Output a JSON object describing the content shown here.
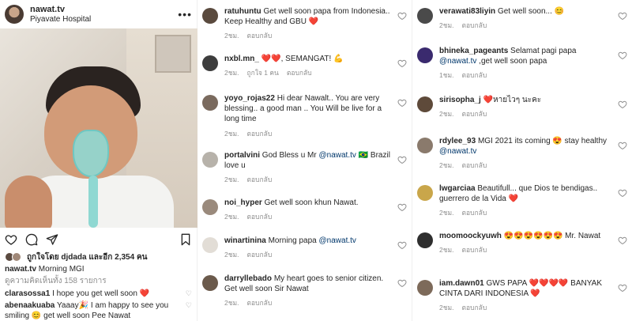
{
  "post": {
    "username": "nawat.tv",
    "location": "Piyavate Hospital",
    "likes_text": "ถูกใจโดย djdada และอีก 2,354 คน",
    "caption_user": "nawat.tv",
    "caption_text": "Morning MGI",
    "view_all": "ดูความคิดเห็นทั้ง 158 รายการ",
    "comments": [
      {
        "user": "clarasossa1",
        "text": "I hope you get well soon ❤️"
      },
      {
        "user": "abenaakuaba",
        "text": "Yaaay🎉 I am happy to see you smiling 😊 get well soon Pee Nawat"
      }
    ]
  },
  "comments_mid": [
    {
      "user": "ratuhuntu",
      "text": "Get well soon papa from Indonesia.. Keep Healthy and GBU ❤️",
      "time": "2ชม.",
      "likes": "",
      "reply": "ตอบกลับ",
      "avatar_color": "#5a4a3e"
    },
    {
      "user": "nxbl.mn_",
      "text": "❤️❤️, SEMANGAT! 💪",
      "time": "2ชม.",
      "likes": "ถูกใจ 1 คน",
      "reply": "ตอบกลับ",
      "avatar_color": "#3d3d3d"
    },
    {
      "user": "yoyo_rojas22",
      "text": "Hi dear Nawalt.. You are very blessing.. a good man .. You Will be live for a long time",
      "time": "2ชม.",
      "likes": "",
      "reply": "ตอบกลับ",
      "avatar_color": "#7a6a5e"
    },
    {
      "user": "portalvini",
      "text": "God Bless u Mr",
      "mention": "@nawat.tv",
      "suffix": " 🇧🇷 Brazil love u",
      "time": "2ชม.",
      "likes": "",
      "reply": "ตอบกลับ",
      "avatar_color": "#b7b2aa"
    },
    {
      "user": "noi_hyper",
      "text": "Get well soon khun Nawat.",
      "time": "2ชม.",
      "likes": "",
      "reply": "ตอบกลับ",
      "avatar_color": "#9a8a7c"
    },
    {
      "user": "winartinina",
      "text": "Morning papa",
      "mention": "@nawat.tv",
      "suffix": "",
      "time": "2ชม.",
      "likes": "",
      "reply": "ตอบกลับ",
      "avatar_color": "#e2ddd6"
    },
    {
      "user": "darryllebado",
      "text": "My heart goes to senior citizen. Get well soon Sir Nawat",
      "time": "2ชม.",
      "likes": "",
      "reply": "ตอบกลับ",
      "avatar_color": "#6b5a4c"
    }
  ],
  "comments_right": [
    {
      "user": "verawati83liyin",
      "text": "Get well soon... 😊",
      "time": "2ชม.",
      "likes": "",
      "reply": "ตอบกลับ",
      "avatar_color": "#4a4a4a"
    },
    {
      "user": "bhineka_pageants",
      "text": "Selamat pagi papa",
      "mention": "@nawat.tv",
      "suffix": " ,get well soon papa",
      "time": "1ชม.",
      "likes": "",
      "reply": "ตอบกลับ",
      "avatar_color": "#3a2a6e"
    },
    {
      "user": "sirisopha_j",
      "text": "❤️หายไวๆ นะคะ",
      "time": "2ชม.",
      "likes": "",
      "reply": "ตอบกลับ",
      "avatar_color": "#5e4a3a"
    },
    {
      "user": "rdylee_93",
      "text": "MGI 2021 its coming 😍 stay healthy",
      "mention": "@nawat.tv",
      "suffix": "",
      "time": "2ชม.",
      "likes": "",
      "reply": "ตอบกลับ",
      "avatar_color": "#8a7a6c"
    },
    {
      "user": "lwgarciaa",
      "text": "Beautifull... que Dios te bendigas.. guerrero de la Vida ❤️",
      "time": "2ชม.",
      "likes": "",
      "reply": "ตอบกลับ",
      "avatar_color": "#c9a64a"
    },
    {
      "user": "moomoockyuwh",
      "text": "😍😍😍😍😍😍 Mr. Nawat",
      "time": "2ชม.",
      "likes": "",
      "reply": "ตอบกลับ",
      "avatar_color": "#2e2e2e"
    },
    {
      "user": "iam.dawn01",
      "text": "GWS PAPA ❤️❤️❤️❤️ BANYAK CINTA DARI INDONESIA ❤️",
      "time": "2ชม.",
      "likes": "",
      "reply": "ตอบกลับ",
      "avatar_color": "#7d6a5a"
    }
  ]
}
